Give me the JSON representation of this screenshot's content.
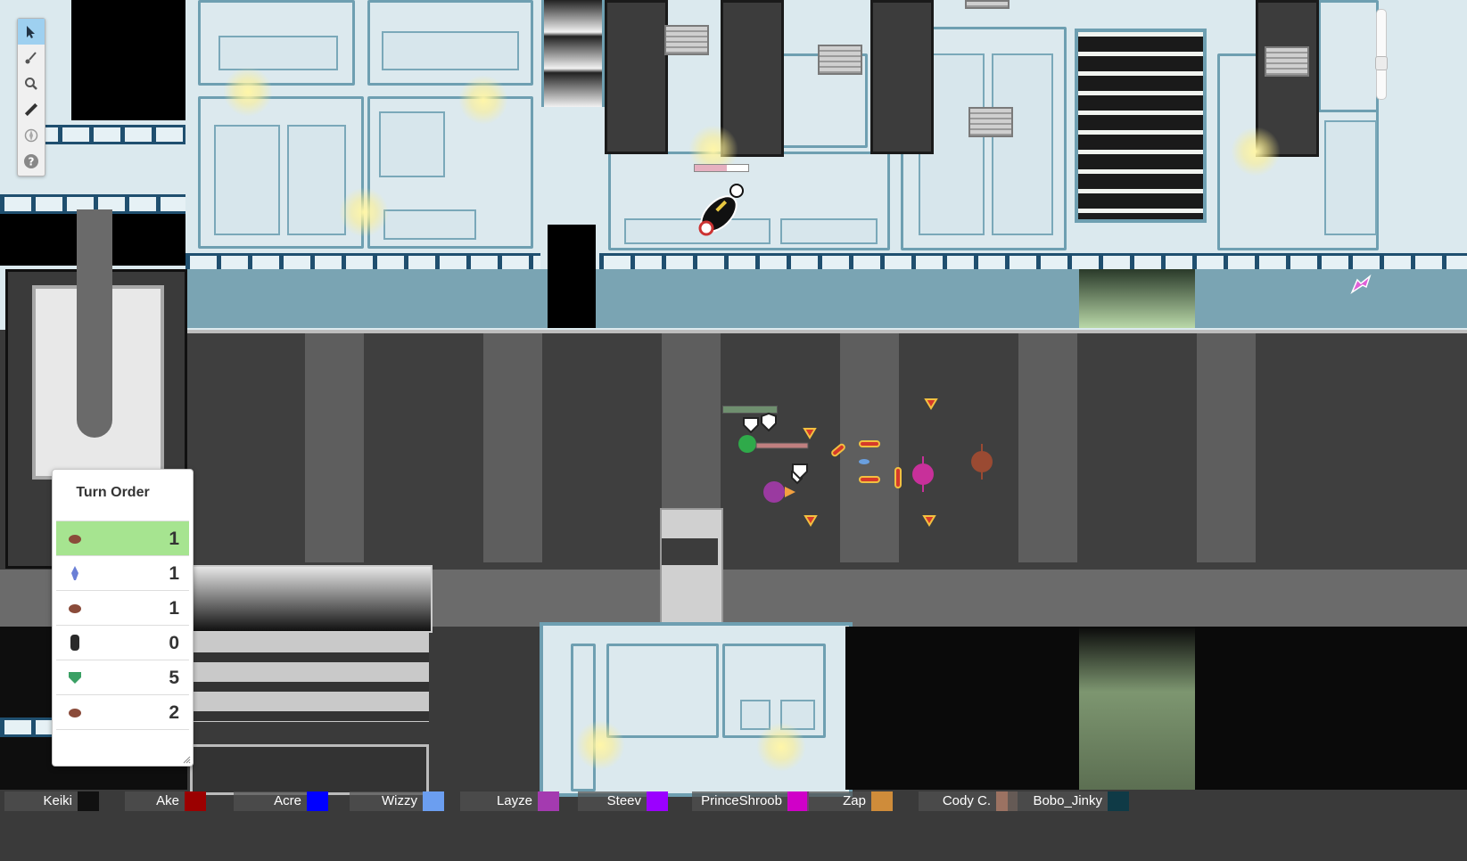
{
  "app": "virtual tabletop map",
  "toolbar": {
    "tools": [
      {
        "id": "select",
        "icon": "pointer-arrow-icon",
        "active": true
      },
      {
        "id": "draw",
        "icon": "brush-icon",
        "active": false
      },
      {
        "id": "zoom",
        "icon": "magnifier-icon",
        "active": false
      },
      {
        "id": "measure",
        "icon": "ruler-icon",
        "active": false
      },
      {
        "id": "fog",
        "icon": "compass-icon",
        "active": false
      },
      {
        "id": "help",
        "icon": "help-icon",
        "active": false
      }
    ]
  },
  "zoom": {
    "level_fraction": 0.62
  },
  "turn_order": {
    "title": "Turn Order",
    "entries": [
      {
        "value": "1",
        "icon": "brown-creature-icon",
        "color": "#8a4b3a",
        "current": true
      },
      {
        "value": "1",
        "icon": "blue-figure-icon",
        "color": "#6a7fd6",
        "current": false
      },
      {
        "value": "1",
        "icon": "brown-creature-icon",
        "color": "#8a4b3a",
        "current": false
      },
      {
        "value": "0",
        "icon": "dark-robot-icon",
        "color": "#2a2a2a",
        "current": false
      },
      {
        "value": "5",
        "icon": "green-shield-icon",
        "color": "#3aa064",
        "current": false
      },
      {
        "value": "2",
        "icon": "brown-creature-icon",
        "color": "#8a4b3a",
        "current": false
      }
    ]
  },
  "players": [
    {
      "name": "Keiki",
      "color": "#111111"
    },
    {
      "name": "Ake",
      "color": "#9b0000"
    },
    {
      "name": "Acre",
      "color": "#0000ff"
    },
    {
      "name": "Wizzy",
      "color": "#6b9ef0"
    },
    {
      "name": "Layze",
      "color": "#a43ab0"
    },
    {
      "name": "Steev",
      "color": "#9b00ff"
    },
    {
      "name": "PrinceShroob",
      "color": "#d000c8"
    },
    {
      "name": "Zap",
      "color": "#cf8c3a"
    },
    {
      "name": "Cody C.",
      "color": "#9b7262"
    },
    {
      "name": "Bobo_Jinky",
      "color": "#0f3a46"
    }
  ]
}
